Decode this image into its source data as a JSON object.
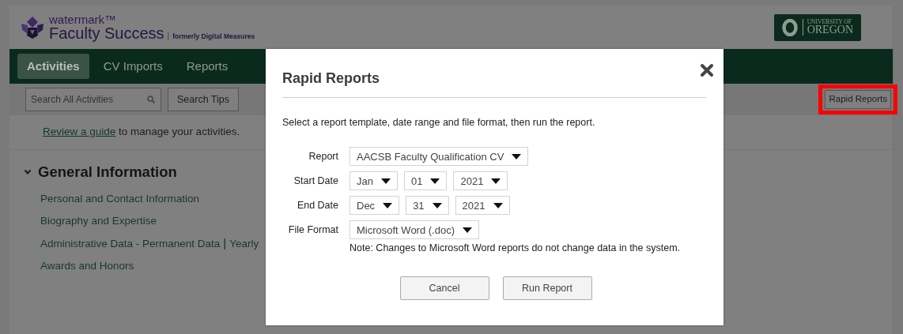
{
  "header": {
    "brand_small": "watermark™",
    "brand": "Faculty Success",
    "brand_separator": "|",
    "brand_note": "formerly Digital Measures",
    "partner_logo": {
      "line1": "UNIVERSITY OF",
      "line2": "OREGON"
    }
  },
  "nav": {
    "tabs": [
      {
        "label": "Activities",
        "selected": true
      },
      {
        "label": "CV Imports",
        "selected": false
      },
      {
        "label": "Reports",
        "selected": false
      }
    ]
  },
  "toolbar": {
    "search": {
      "placeholder": "Search All Activities"
    },
    "search_tips": "Search Tips",
    "rapid_reports": {
      "label": "Rapid Reports",
      "highlighted": true
    }
  },
  "guide": {
    "link": "Review a guide",
    "text": " to manage your activities."
  },
  "section": {
    "title": "General Information",
    "expanded": true,
    "separator": "|",
    "items": [
      {
        "links": [
          "Personal and Contact Information"
        ]
      },
      {
        "links": [
          "Biography and Expertise"
        ]
      },
      {
        "links": [
          "Administrative Data - Permanent Data",
          "Yearly"
        ]
      },
      {
        "links": [
          "Awards and Honors"
        ]
      }
    ]
  },
  "dialog": {
    "title": "Rapid Reports",
    "description": "Select a report template, date range and file format, then run the report.",
    "fields": [
      {
        "label": "Report",
        "selects": [
          "AACSB Faculty Qualification CV"
        ]
      },
      {
        "label": "Start Date",
        "selects": [
          "Jan",
          "01",
          "2021"
        ]
      },
      {
        "label": "End Date",
        "selects": [
          "Dec",
          "31",
          "2021"
        ]
      },
      {
        "label": "File Format",
        "selects": [
          "Microsoft Word (.doc)"
        ],
        "note": "Note: Changes to Microsoft Word reports do not change data in the system."
      }
    ],
    "buttons": [
      "Cancel",
      "Run Report"
    ]
  }
}
